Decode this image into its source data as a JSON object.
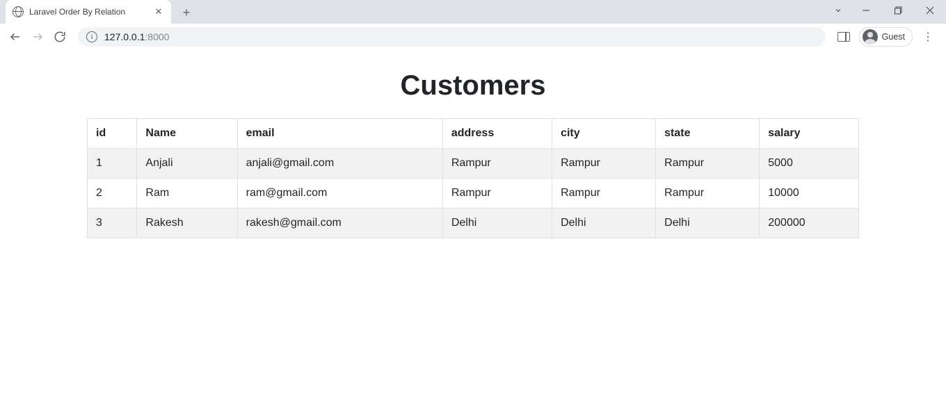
{
  "browser": {
    "tab_title": "Laravel Order By Relation",
    "url_host": "127.0.0.1",
    "url_port": ":8000",
    "profile_label": "Guest"
  },
  "page": {
    "heading": "Customers",
    "columns": [
      "id",
      "Name",
      "email",
      "address",
      "city",
      "state",
      "salary"
    ],
    "rows": [
      {
        "id": "1",
        "name": "Anjali",
        "email": "anjali@gmail.com",
        "address": "Rampur",
        "city": "Rampur",
        "state": "Rampur",
        "salary": "5000"
      },
      {
        "id": "2",
        "name": "Ram",
        "email": "ram@gmail.com",
        "address": "Rampur",
        "city": "Rampur",
        "state": "Rampur",
        "salary": "10000"
      },
      {
        "id": "3",
        "name": "Rakesh",
        "email": "rakesh@gmail.com",
        "address": "Delhi",
        "city": "Delhi",
        "state": "Delhi",
        "salary": "200000"
      }
    ]
  }
}
